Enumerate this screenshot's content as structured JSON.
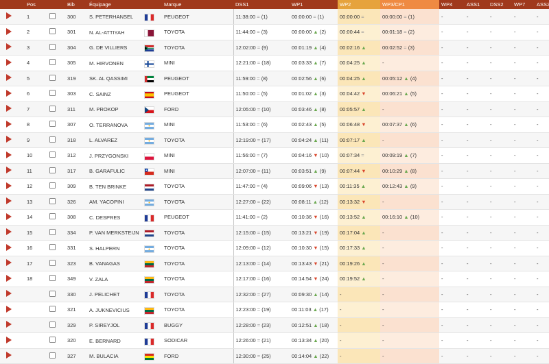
{
  "headers": {
    "pos": "Pos",
    "bib": "Bib",
    "crew": "Équipage",
    "brand": "Marque",
    "dss1": "DSS1",
    "wp1": "WP1",
    "wp2": "WP2",
    "wp3cp1": "WP3/CP1",
    "wp4": "WP4",
    "ass1": "ASS1",
    "dss2": "DSS2",
    "wp7": "WP7",
    "ass2": "ASS2"
  },
  "colors": {
    "header": "#a0391c",
    "wp2_header": "#e6a33c",
    "wp3_header": "#ef8a42",
    "arrow_up": "#6aa84f",
    "arrow_down": "#d9462c",
    "play": "#c0392b"
  },
  "rows": [
    {
      "pos": "1",
      "bib": "300",
      "crew": "S. PETERHANSEL",
      "flag": "fr",
      "brand": "PEUGEOT",
      "dss1": "11:38:00",
      "dss1_trend": "=",
      "dss1_rank": "(1)",
      "wp1": "00:00:00",
      "wp1_trend": "=",
      "wp1_rank": "(1)",
      "wp2": "00:00:00",
      "wp2_trend": "=",
      "wp3": "00:00:00",
      "wp3_trend": "=",
      "wp3_rank": "(1)",
      "wp4": "-",
      "ass1": "-",
      "dss2": "-",
      "wp7": "-",
      "ass2": "-"
    },
    {
      "pos": "2",
      "bib": "301",
      "crew": "N. AL-ATTIYAH",
      "flag": "qa",
      "brand": "TOYOTA",
      "dss1": "11:44:00",
      "dss1_trend": "=",
      "dss1_rank": "(3)",
      "wp1": "00:00:00",
      "wp1_trend": "▲",
      "wp1_rank": "(2)",
      "wp2": "00:00:44",
      "wp2_trend": "=",
      "wp3": "00:01:18",
      "wp3_trend": "=",
      "wp3_rank": "(2)",
      "wp4": "-",
      "ass1": "-",
      "dss2": "-",
      "wp7": "-",
      "ass2": "-"
    },
    {
      "pos": "3",
      "bib": "304",
      "crew": "G. DE VILLIERS",
      "flag": "za",
      "brand": "TOYOTA",
      "dss1": "12:02:00",
      "dss1_trend": "=",
      "dss1_rank": "(9)",
      "wp1": "00:01:19",
      "wp1_trend": "▲",
      "wp1_rank": "(4)",
      "wp2": "00:02:16",
      "wp2_trend": "▲",
      "wp3": "00:02:52",
      "wp3_trend": "=",
      "wp3_rank": "(3)",
      "wp4": "-",
      "ass1": "-",
      "dss2": "-",
      "wp7": "-",
      "ass2": "-"
    },
    {
      "pos": "4",
      "bib": "305",
      "crew": "M. HIRVONEN",
      "flag": "fi",
      "brand": "MINI",
      "dss1": "12:21:00",
      "dss1_trend": "=",
      "dss1_rank": "(18)",
      "wp1": "00:03:33",
      "wp1_trend": "▲",
      "wp1_rank": "(7)",
      "wp2": "00:04:25",
      "wp2_trend": "▲",
      "wp3": "-",
      "wp3_trend": "",
      "wp3_rank": "",
      "wp4": "-",
      "ass1": "-",
      "dss2": "-",
      "wp7": "-",
      "ass2": "-"
    },
    {
      "pos": "5",
      "bib": "319",
      "crew": "SK. AL QASSIMI",
      "flag": "ae",
      "brand": "PEUGEOT",
      "dss1": "11:59:00",
      "dss1_trend": "=",
      "dss1_rank": "(8)",
      "wp1": "00:02:56",
      "wp1_trend": "▲",
      "wp1_rank": "(6)",
      "wp2": "00:04:25",
      "wp2_trend": "▲",
      "wp3": "00:05:12",
      "wp3_trend": "▲",
      "wp3_rank": "(4)",
      "wp4": "-",
      "ass1": "-",
      "dss2": "-",
      "wp7": "-",
      "ass2": "-"
    },
    {
      "pos": "6",
      "bib": "303",
      "crew": "C. SAINZ",
      "flag": "es",
      "brand": "PEUGEOT",
      "dss1": "11:50:00",
      "dss1_trend": "=",
      "dss1_rank": "(5)",
      "wp1": "00:01:02",
      "wp1_trend": "▲",
      "wp1_rank": "(3)",
      "wp2": "00:04:42",
      "wp2_trend": "▼",
      "wp3": "00:06:21",
      "wp3_trend": "▲",
      "wp3_rank": "(5)",
      "wp4": "-",
      "ass1": "-",
      "dss2": "-",
      "wp7": "-",
      "ass2": "-"
    },
    {
      "pos": "7",
      "bib": "311",
      "crew": "M. PROKOP",
      "flag": "cz",
      "brand": "FORD",
      "dss1": "12:05:00",
      "dss1_trend": "=",
      "dss1_rank": "(10)",
      "wp1": "00:03:46",
      "wp1_trend": "▲",
      "wp1_rank": "(8)",
      "wp2": "00:05:57",
      "wp2_trend": "▲",
      "wp3": "-",
      "wp3_trend": "",
      "wp3_rank": "",
      "wp4": "-",
      "ass1": "-",
      "dss2": "-",
      "wp7": "-",
      "ass2": "-"
    },
    {
      "pos": "8",
      "bib": "307",
      "crew": "O. TERRANOVA",
      "flag": "ar",
      "brand": "MINI",
      "dss1": "11:53:00",
      "dss1_trend": "=",
      "dss1_rank": "(6)",
      "wp1": "00:02:43",
      "wp1_trend": "▲",
      "wp1_rank": "(5)",
      "wp2": "00:06:48",
      "wp2_trend": "▼",
      "wp3": "00:07:37",
      "wp3_trend": "▲",
      "wp3_rank": "(6)",
      "wp4": "-",
      "ass1": "-",
      "dss2": "-",
      "wp7": "-",
      "ass2": "-"
    },
    {
      "pos": "9",
      "bib": "318",
      "crew": "L. ALVAREZ",
      "flag": "ar",
      "brand": "TOYOTA",
      "dss1": "12:19:00",
      "dss1_trend": "=",
      "dss1_rank": "(17)",
      "wp1": "00:04:24",
      "wp1_trend": "▲",
      "wp1_rank": "(11)",
      "wp2": "00:07:17",
      "wp2_trend": "▲",
      "wp3": "-",
      "wp3_trend": "",
      "wp3_rank": "",
      "wp4": "-",
      "ass1": "-",
      "dss2": "-",
      "wp7": "-",
      "ass2": "-"
    },
    {
      "pos": "10",
      "bib": "312",
      "crew": "J. PRZYGONSKI",
      "flag": "pl",
      "brand": "MINI",
      "dss1": "11:56:00",
      "dss1_trend": "=",
      "dss1_rank": "(7)",
      "wp1": "00:04:16",
      "wp1_trend": "▼",
      "wp1_rank": "(10)",
      "wp2": "00:07:34",
      "wp2_trend": "=",
      "wp3": "00:09:19",
      "wp3_trend": "▲",
      "wp3_rank": "(7)",
      "wp4": "-",
      "ass1": "-",
      "dss2": "-",
      "wp7": "-",
      "ass2": "-"
    },
    {
      "pos": "11",
      "bib": "317",
      "crew": "B. GARAFULIC",
      "flag": "cl",
      "brand": "MINI",
      "dss1": "12:07:00",
      "dss1_trend": "=",
      "dss1_rank": "(11)",
      "wp1": "00:03:51",
      "wp1_trend": "▲",
      "wp1_rank": "(9)",
      "wp2": "00:07:44",
      "wp2_trend": "▼",
      "wp3": "00:10:29",
      "wp3_trend": "▲",
      "wp3_rank": "(8)",
      "wp4": "-",
      "ass1": "-",
      "dss2": "-",
      "wp7": "-",
      "ass2": "-"
    },
    {
      "pos": "12",
      "bib": "309",
      "crew": "B. TEN BRINKE",
      "flag": "nl",
      "brand": "TOYOTA",
      "dss1": "11:47:00",
      "dss1_trend": "=",
      "dss1_rank": "(4)",
      "wp1": "00:09:06",
      "wp1_trend": "▼",
      "wp1_rank": "(13)",
      "wp2": "00:11:35",
      "wp2_trend": "▲",
      "wp3": "00:12:43",
      "wp3_trend": "▲",
      "wp3_rank": "(9)",
      "wp4": "-",
      "ass1": "-",
      "dss2": "-",
      "wp7": "-",
      "ass2": "-"
    },
    {
      "pos": "13",
      "bib": "326",
      "crew": "AM. YACOPINI",
      "flag": "ar",
      "brand": "TOYOTA",
      "dss1": "12:27:00",
      "dss1_trend": "=",
      "dss1_rank": "(22)",
      "wp1": "00:08:11",
      "wp1_trend": "▲",
      "wp1_rank": "(12)",
      "wp2": "00:13:32",
      "wp2_trend": "▼",
      "wp3": "-",
      "wp3_trend": "",
      "wp3_rank": "",
      "wp4": "-",
      "ass1": "-",
      "dss2": "-",
      "wp7": "-",
      "ass2": "-"
    },
    {
      "pos": "14",
      "bib": "308",
      "crew": "C. DESPRES",
      "flag": "fr",
      "brand": "PEUGEOT",
      "dss1": "11:41:00",
      "dss1_trend": "=",
      "dss1_rank": "(2)",
      "wp1": "00:10:36",
      "wp1_trend": "▼",
      "wp1_rank": "(16)",
      "wp2": "00:13:52",
      "wp2_trend": "▲",
      "wp3": "00:16:10",
      "wp3_trend": "▲",
      "wp3_rank": "(10)",
      "wp4": "-",
      "ass1": "-",
      "dss2": "-",
      "wp7": "-",
      "ass2": "-"
    },
    {
      "pos": "15",
      "bib": "334",
      "crew": "P. VAN MERKSTEIJN",
      "flag": "nl",
      "brand": "TOYOTA",
      "dss1": "12:15:00",
      "dss1_trend": "=",
      "dss1_rank": "(15)",
      "wp1": "00:13:21",
      "wp1_trend": "▼",
      "wp1_rank": "(19)",
      "wp2": "00:17:04",
      "wp2_trend": "▲",
      "wp3": "-",
      "wp3_trend": "",
      "wp3_rank": "",
      "wp4": "-",
      "ass1": "-",
      "dss2": "-",
      "wp7": "-",
      "ass2": "-"
    },
    {
      "pos": "16",
      "bib": "331",
      "crew": "S. HALPERN",
      "flag": "ar",
      "brand": "TOYOTA",
      "dss1": "12:09:00",
      "dss1_trend": "=",
      "dss1_rank": "(12)",
      "wp1": "00:10:30",
      "wp1_trend": "▼",
      "wp1_rank": "(15)",
      "wp2": "00:17:33",
      "wp2_trend": "▲",
      "wp3": "-",
      "wp3_trend": "",
      "wp3_rank": "",
      "wp4": "-",
      "ass1": "-",
      "dss2": "-",
      "wp7": "-",
      "ass2": "-"
    },
    {
      "pos": "17",
      "bib": "323",
      "crew": "B. VANAGAS",
      "flag": "lt",
      "brand": "TOYOTA",
      "dss1": "12:13:00",
      "dss1_trend": "=",
      "dss1_rank": "(14)",
      "wp1": "00:13:43",
      "wp1_trend": "▼",
      "wp1_rank": "(21)",
      "wp2": "00:19:26",
      "wp2_trend": "▲",
      "wp3": "-",
      "wp3_trend": "",
      "wp3_rank": "",
      "wp4": "-",
      "ass1": "-",
      "dss2": "-",
      "wp7": "-",
      "ass2": "-"
    },
    {
      "pos": "18",
      "bib": "349",
      "crew": "V. ZALA",
      "flag": "lt",
      "brand": "TOYOTA",
      "dss1": "12:17:00",
      "dss1_trend": "=",
      "dss1_rank": "(16)",
      "wp1": "00:14:54",
      "wp1_trend": "▼",
      "wp1_rank": "(24)",
      "wp2": "00:19:52",
      "wp2_trend": "▲",
      "wp3": "-",
      "wp3_trend": "",
      "wp3_rank": "",
      "wp4": "-",
      "ass1": "-",
      "dss2": "-",
      "wp7": "-",
      "ass2": "-"
    },
    {
      "pos": "",
      "bib": "330",
      "crew": "J. PELICHET",
      "flag": "fr",
      "brand": "TOYOTA",
      "dss1": "12:32:00",
      "dss1_trend": "=",
      "dss1_rank": "(27)",
      "wp1": "00:09:30",
      "wp1_trend": "▲",
      "wp1_rank": "(14)",
      "wp2": "-",
      "wp2_trend": "",
      "wp3": "-",
      "wp3_trend": "",
      "wp3_rank": "",
      "wp4": "-",
      "ass1": "-",
      "dss2": "-",
      "wp7": "-",
      "ass2": "-"
    },
    {
      "pos": "",
      "bib": "321",
      "crew": "A. JUKNEVICIUS",
      "flag": "lt",
      "brand": "TOYOTA",
      "dss1": "12:23:00",
      "dss1_trend": "=",
      "dss1_rank": "(19)",
      "wp1": "00:11:03",
      "wp1_trend": "▲",
      "wp1_rank": "(17)",
      "wp2": "-",
      "wp2_trend": "",
      "wp3": "-",
      "wp3_trend": "",
      "wp3_rank": "",
      "wp4": "-",
      "ass1": "-",
      "dss2": "-",
      "wp7": "-",
      "ass2": "-"
    },
    {
      "pos": "",
      "bib": "329",
      "crew": "P. SIREYJOL",
      "flag": "fr",
      "brand": "BUGGY",
      "dss1": "12:28:00",
      "dss1_trend": "=",
      "dss1_rank": "(23)",
      "wp1": "00:12:51",
      "wp1_trend": "▲",
      "wp1_rank": "(18)",
      "wp2": "-",
      "wp2_trend": "",
      "wp3": "-",
      "wp3_trend": "",
      "wp3_rank": "",
      "wp4": "-",
      "ass1": "-",
      "dss2": "-",
      "wp7": "-",
      "ass2": "-"
    },
    {
      "pos": "",
      "bib": "320",
      "crew": "E. BERNARD",
      "flag": "fr",
      "brand": "SODICAR",
      "dss1": "12:26:00",
      "dss1_trend": "=",
      "dss1_rank": "(21)",
      "wp1": "00:13:34",
      "wp1_trend": "▲",
      "wp1_rank": "(20)",
      "wp2": "-",
      "wp2_trend": "",
      "wp3": "-",
      "wp3_trend": "",
      "wp3_rank": "",
      "wp4": "-",
      "ass1": "-",
      "dss2": "-",
      "wp7": "-",
      "ass2": "-"
    },
    {
      "pos": "",
      "bib": "327",
      "crew": "M. BULACIA",
      "flag": "bo",
      "brand": "FORD",
      "dss1": "12:30:00",
      "dss1_trend": "=",
      "dss1_rank": "(25)",
      "wp1": "00:14:04",
      "wp1_trend": "▲",
      "wp1_rank": "(22)",
      "wp2": "-",
      "wp2_trend": "",
      "wp3": "-",
      "wp3_trend": "",
      "wp3_rank": "",
      "wp4": "-",
      "ass1": "-",
      "dss2": "-",
      "wp7": "-",
      "ass2": "-"
    }
  ]
}
